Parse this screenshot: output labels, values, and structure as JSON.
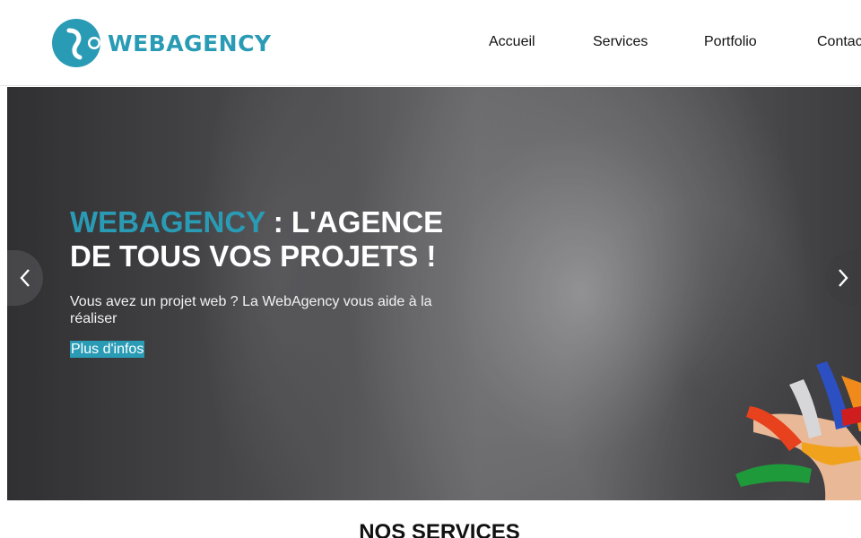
{
  "brand": {
    "name": "WEBAGENCY",
    "color": "#2a9bb5"
  },
  "nav": {
    "items": [
      "Accueil",
      "Services",
      "Portfolio",
      "Contac"
    ]
  },
  "hero": {
    "title_brand": "WEBAGENCY",
    "title_rest": " : L'AGENCE DE TOUS VOS PROJETS !",
    "subtitle": "Vous avez un projet web ? La WebAgency vous aide à la réaliser",
    "cta": "Plus d'infos"
  },
  "carousel": {
    "prev_icon": "chevron-left-icon",
    "next_icon": "chevron-right-icon"
  },
  "services": {
    "title": "NOS SERVICES"
  }
}
